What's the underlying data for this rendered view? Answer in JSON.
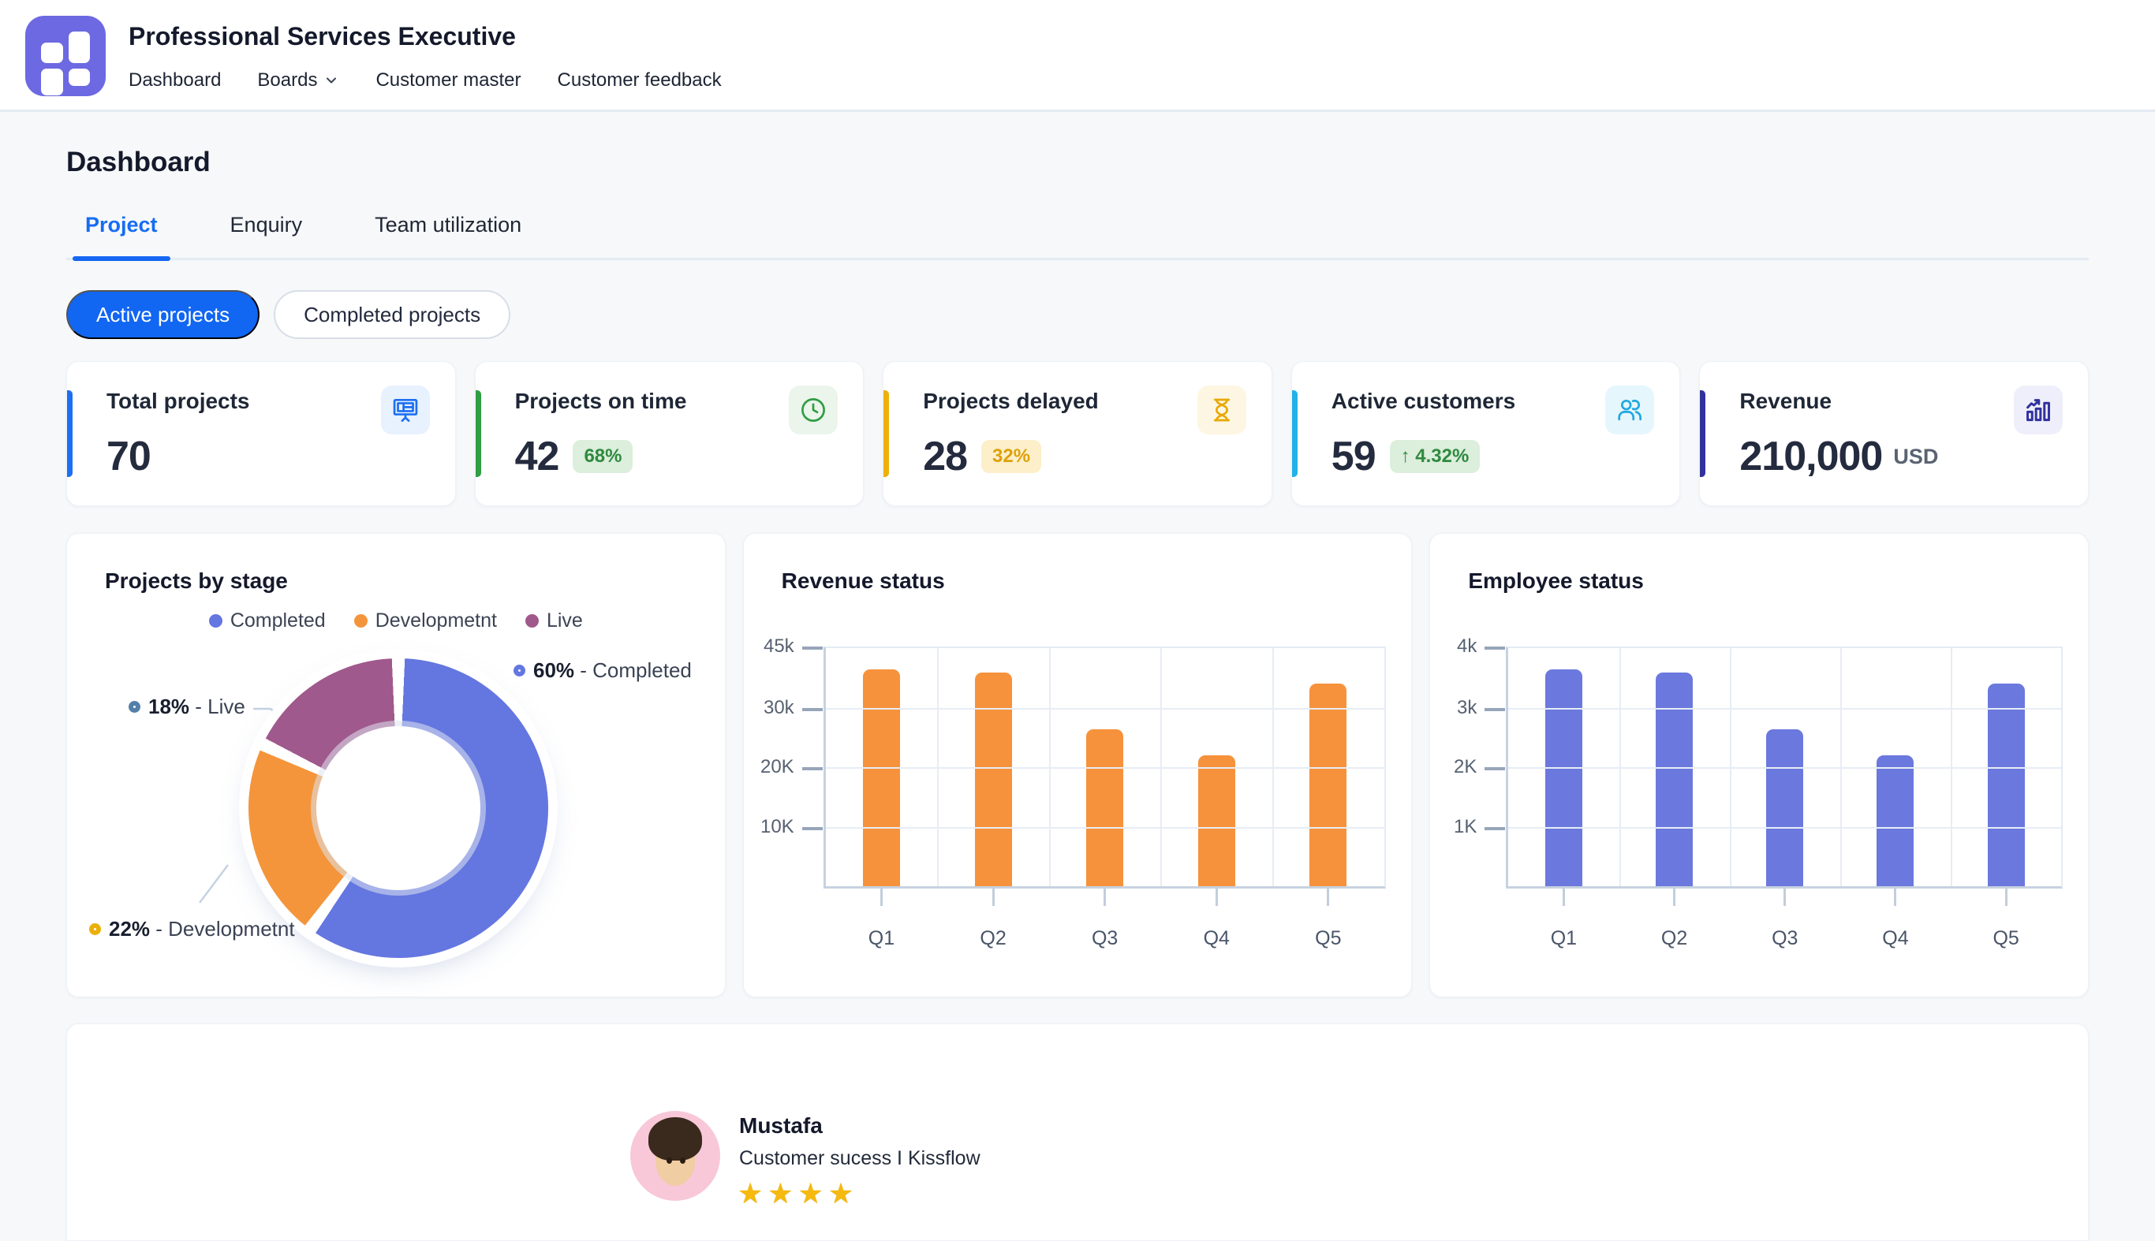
{
  "header": {
    "app_title": "Professional Services Executive",
    "nav": [
      {
        "label": "Dashboard"
      },
      {
        "label": "Boards",
        "has_dropdown": true
      },
      {
        "label": "Customer master"
      },
      {
        "label": "Customer feedback"
      }
    ]
  },
  "page": {
    "title": "Dashboard",
    "tabs": [
      {
        "label": "Project",
        "active": true
      },
      {
        "label": "Enquiry",
        "active": false
      },
      {
        "label": "Team utilization",
        "active": false
      }
    ],
    "filters": [
      {
        "label": "Active projects",
        "selected": true
      },
      {
        "label": "Completed projects",
        "selected": false
      }
    ]
  },
  "stats": {
    "cards": [
      {
        "title": "Total projects",
        "value": "70",
        "accent": "#1C6FF3",
        "icon": "presentation-board-icon",
        "icon_color": "#1C6FF3",
        "icon_bg": "#E8F1FE"
      },
      {
        "title": "Projects on time",
        "value": "42",
        "badge": "68%",
        "badge_color": "#2F8A3E",
        "badge_bg": "#DCEEDC",
        "accent": "#2F9E44",
        "icon": "clock-icon",
        "icon_color": "#2F9E44",
        "icon_bg": "#EBF5EB"
      },
      {
        "title": "Projects delayed",
        "value": "28",
        "badge": "32%",
        "badge_color": "#DDA10A",
        "badge_bg": "#FCEFC9",
        "accent": "#EFB008",
        "icon": "hourglass-icon",
        "icon_color": "#E9A800",
        "icon_bg": "#FDF6E2"
      },
      {
        "title": "Active customers",
        "value": "59",
        "badge": "↑ 4.32%",
        "badge_color": "#2F8A3E",
        "badge_bg": "#DCEEDC",
        "accent": "#22B1E8",
        "icon": "people-icon",
        "icon_color": "#1FA8E0",
        "icon_bg": "#E6F6FD"
      },
      {
        "title": "Revenue",
        "value": "210,000",
        "suffix": "USD",
        "accent": "#32329E",
        "icon": "bar-chart-trend-icon",
        "icon_color": "#32329E",
        "icon_bg": "#EFEFFB"
      }
    ]
  },
  "chart_data": [
    {
      "type": "pie",
      "title": "Projects by stage",
      "legend_position": "top-center",
      "slices": [
        {
          "label": "Completed",
          "pct": 60,
          "color": "#6476E0"
        },
        {
          "label": "Developmetnt",
          "pct": 22,
          "color": "#F4953B"
        },
        {
          "label": "Live",
          "pct": 18,
          "color": "#A0598C"
        }
      ],
      "callouts": [
        {
          "bold": "60%",
          "rest": " - Completed",
          "marker": "#6476E0"
        },
        {
          "bold": "18%",
          "rest": " - Live",
          "marker": "#5380A8"
        },
        {
          "bold": "22%",
          "rest": " - Developmetnt",
          "marker": "#EBB008"
        }
      ],
      "donut_hole_pct": 55,
      "start_angle_deg": 0
    },
    {
      "type": "bar",
      "title": "Revenue status",
      "categories": [
        "Q1",
        "Q2",
        "Q3",
        "Q4",
        "Q5"
      ],
      "values": [
        39500,
        39000,
        26500,
        22500,
        36000
      ],
      "height_pct": [
        90.9,
        89.8,
        65.9,
        55.1,
        85.2
      ],
      "y_ticks": [
        "45k",
        "30k",
        "20K",
        "10K"
      ],
      "ylim": [
        0,
        45000
      ],
      "grid": true,
      "bar_color": "#F6923B",
      "xlabel": "",
      "ylabel": ""
    },
    {
      "type": "bar",
      "title": "Employee status",
      "categories": [
        "Q1",
        "Q2",
        "Q3",
        "Q4",
        "Q5"
      ],
      "values": [
        3650,
        3600,
        2650,
        2250,
        3400
      ],
      "height_pct": [
        90.9,
        89.8,
        65.9,
        55.1,
        85.2
      ],
      "y_ticks": [
        "4k",
        "3k",
        "2K",
        "1K"
      ],
      "ylim": [
        0,
        4000
      ],
      "grid": true,
      "bar_color": "#6B78DD",
      "xlabel": "",
      "ylabel": ""
    }
  ],
  "feedback": {
    "name": "Mustafa",
    "role": "Customer sucess I Kissflow",
    "stars": 4,
    "stars_display": "★★★★"
  }
}
